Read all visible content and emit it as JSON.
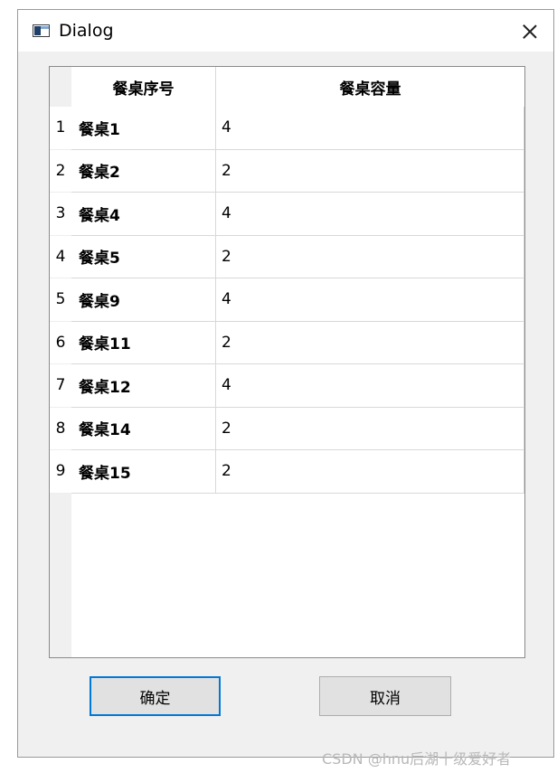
{
  "window": {
    "title": "Dialog"
  },
  "table": {
    "columns": [
      "餐桌序号",
      "餐桌容量"
    ],
    "rows": [
      {
        "num": "1",
        "name": "餐桌1",
        "capacity": "4"
      },
      {
        "num": "2",
        "name": "餐桌2",
        "capacity": "2"
      },
      {
        "num": "3",
        "name": "餐桌4",
        "capacity": "4"
      },
      {
        "num": "4",
        "name": "餐桌5",
        "capacity": "2"
      },
      {
        "num": "5",
        "name": "餐桌9",
        "capacity": "4"
      },
      {
        "num": "6",
        "name": "餐桌11",
        "capacity": "2"
      },
      {
        "num": "7",
        "name": "餐桌12",
        "capacity": "4"
      },
      {
        "num": "8",
        "name": "餐桌14",
        "capacity": "2"
      },
      {
        "num": "9",
        "name": "餐桌15",
        "capacity": "2"
      }
    ]
  },
  "buttons": {
    "ok_label": "确定",
    "cancel_label": "取消"
  },
  "watermark": "CSDN @hnu后湖十级爱好者",
  "icons": {
    "window_icon": "app-window-icon",
    "close": "close-icon"
  },
  "colors": {
    "focus_border": "#0078d7",
    "dialog_bg": "#f0f0f0"
  }
}
